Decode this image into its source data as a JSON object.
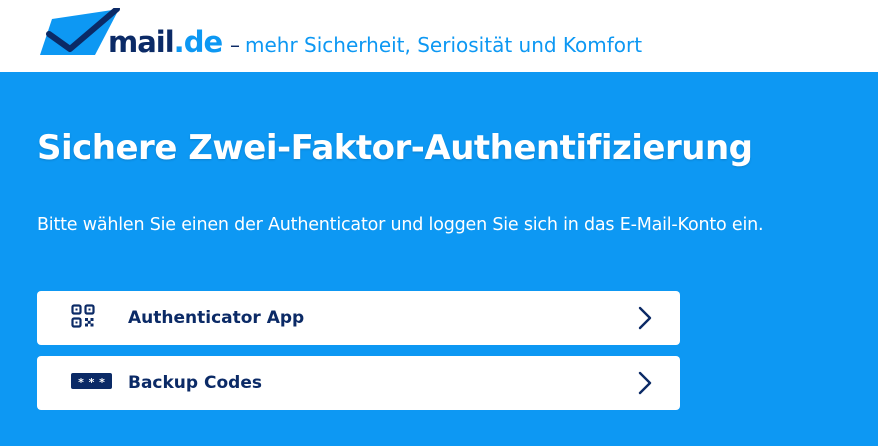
{
  "header": {
    "logo_name": "mail",
    "logo_tld": ".de",
    "tagline_dash": "–",
    "tagline": "mehr Sicherheit, Seriosität und Komfort"
  },
  "main": {
    "title": "Sichere Zwei-Faktor-Authentifizierung",
    "subtitle": "Bitte wählen Sie einen der Authenticator und loggen Sie sich in das E-Mail-Konto ein.",
    "options": [
      {
        "label": "Authenticator App",
        "icon": "qr-code-icon"
      },
      {
        "label": "Backup Codes",
        "icon": "password-dots-icon"
      }
    ]
  },
  "colors": {
    "background": "#0d98f3",
    "navy": "#0b2a66",
    "white": "#ffffff"
  }
}
